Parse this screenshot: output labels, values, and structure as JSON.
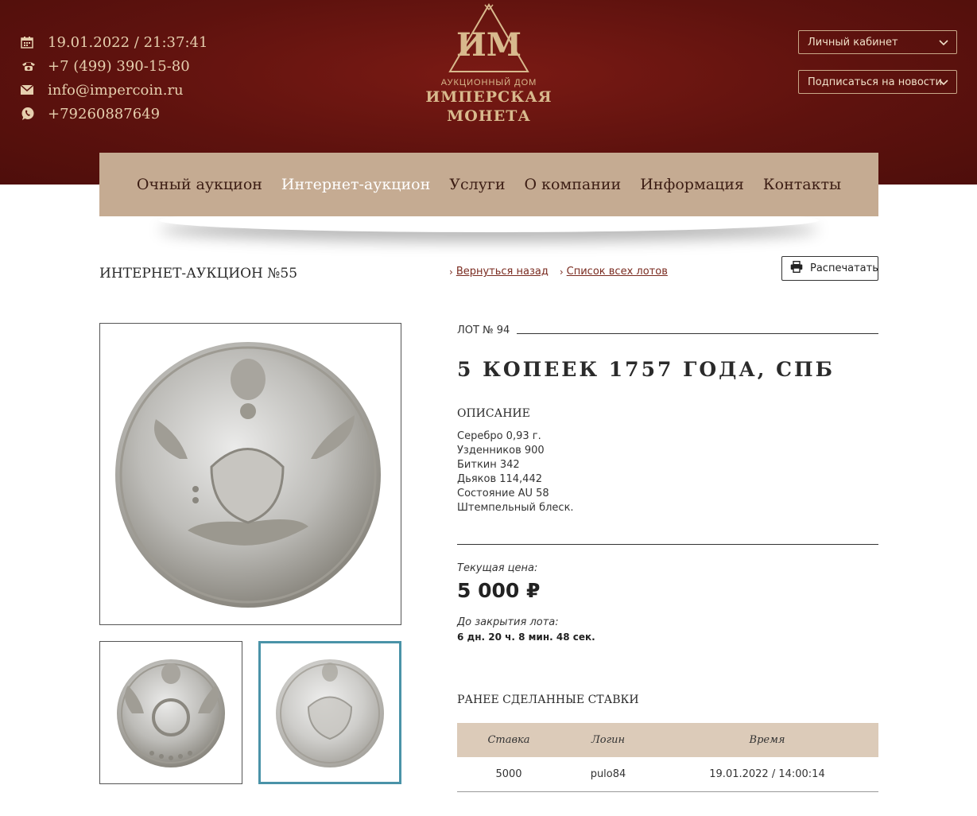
{
  "header": {
    "contacts": [
      {
        "icon": "calendar-icon",
        "text": "19.01.2022 / 21:37:41"
      },
      {
        "icon": "phone-icon",
        "text": "+7 (499) 390-15-80"
      },
      {
        "icon": "mail-icon",
        "text": "info@impercoin.ru"
      },
      {
        "icon": "whatsapp-icon",
        "text": "+79260887649"
      }
    ],
    "logo": {
      "mark": "ИМ",
      "subtitle": "АУКЦИОННЫЙ ДОМ",
      "name_line1": "ИМПЕРСКАЯ",
      "name_line2": "МОНЕТА"
    },
    "account_select": "Личный кабинет",
    "subscribe_select": "Подписаться на новости"
  },
  "nav": {
    "items": [
      "Очный аукцион",
      "Интернет-аукцион",
      "Услуги",
      "О компании",
      "Информация",
      "Контакты"
    ],
    "active": "Интернет-аукцион"
  },
  "page": {
    "title": "ИНТЕРНЕТ-АУКЦИОН №55",
    "back_link": "Вернуться назад",
    "lots_link": "Список всех лотов",
    "print_label": "Распечатать"
  },
  "lot": {
    "number": "ЛОТ № 94",
    "title": "5 КОПЕЕК 1757 ГОДА, СПБ",
    "description_heading": "ОПИСАНИЕ",
    "description": [
      "Серебро 0,93 г.",
      "Узденников 900",
      "Биткин 342",
      "Дьяков 114,442",
      "Состояние AU 58",
      "Штемпельный блеск."
    ],
    "price_label": "Текущая цена:",
    "price": "5 000 ₽",
    "close_label": "До закрытия лота:",
    "close_value": "6 дн. 20 ч. 8 мин. 48 сек."
  },
  "bids": {
    "heading": "РАНЕЕ СДЕЛАННЫЕ СТАВКИ",
    "columns": [
      "Ставка",
      "Логин",
      "Время"
    ],
    "rows": [
      {
        "bid": "5000",
        "login": "pulo84",
        "time": "19.01.2022 / 14:00:14"
      }
    ]
  },
  "colors": {
    "header_bg": "#5e120e",
    "nav_bg": "#c5ab92",
    "gold": "#d8b98d",
    "link": "#7a2b20",
    "thumb_selected": "#4a93a8"
  }
}
